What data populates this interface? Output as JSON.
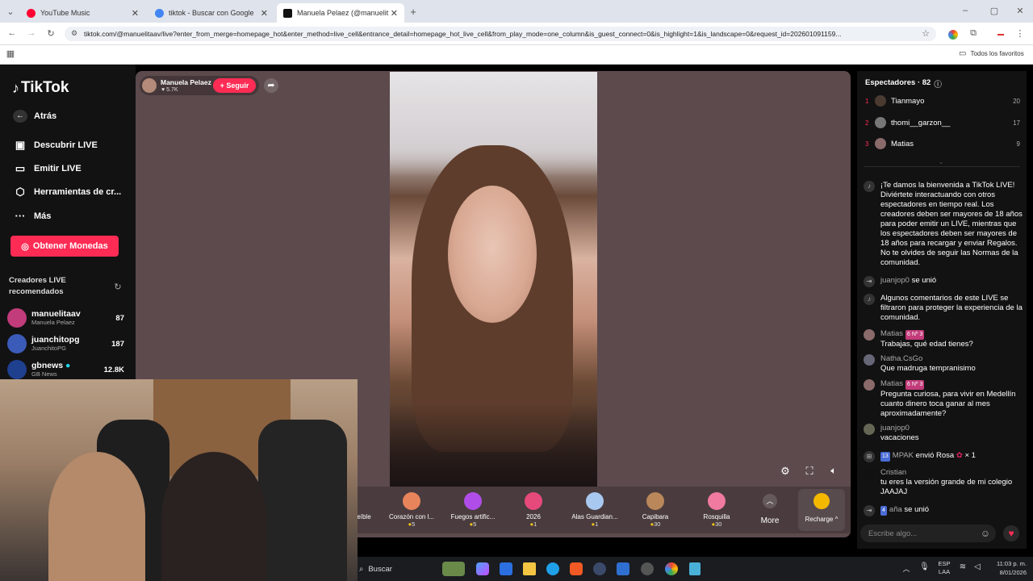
{
  "browser": {
    "tabs": [
      {
        "title": "YouTube Music",
        "color": "#ff0033"
      },
      {
        "title": "tiktok - Buscar con Google",
        "color": "#4285f4"
      },
      {
        "title": "Manuela Pelaez (@manuelit",
        "color": "#111111"
      }
    ],
    "url": "tiktok.com/@manuelitaav/live?enter_from_merge=homepage_hot&enter_method=live_cell&entrance_detail=homepage_hot_live_cell&from_play_mode=one_column&is_guest_connect=0&is_highlight=1&is_landscape=0&request_id=202601091159...",
    "bookmarks_label": "Todos los favoritos"
  },
  "tiktok": {
    "logo": "TikTok",
    "nav": [
      {
        "label": "Atrás",
        "icon": "back-arrow-icon"
      },
      {
        "label": "Descubrir LIVE",
        "icon": "live-calendar-icon"
      },
      {
        "label": "Emitir LIVE",
        "icon": "camera-icon"
      },
      {
        "label": "Herramientas de cr...",
        "icon": "tools-icon"
      },
      {
        "label": "Más",
        "icon": "more-icon"
      }
    ],
    "coins_button": "Obtener Monedas",
    "recommended_title": "Creadores LIVE recomendados",
    "creators": [
      {
        "name": "manuelitaav",
        "sub": "Manuela Pelaez",
        "count": "87",
        "color": "#c23b7a"
      },
      {
        "name": "juanchitopg",
        "sub": "JuanchitoPG",
        "count": "187",
        "color": "#3b5bb8"
      },
      {
        "name": "gbnews",
        "sub": "GB News",
        "count": "12.8K",
        "color": "#1f3f8f"
      }
    ]
  },
  "stream": {
    "host_name": "Manuela Pelaez",
    "host_likes": "5.7K",
    "follow_label": "+ Seguir",
    "gifts": [
      {
        "name": "eíble",
        "price": ""
      },
      {
        "name": "Corazón con l...",
        "price": "5",
        "color": "#e8845c"
      },
      {
        "name": "Fuegos artific...",
        "price": "5",
        "color": "#b04de8"
      },
      {
        "name": "2026",
        "price": "1",
        "color": "#e64a7a"
      },
      {
        "name": "Alas Guardian...",
        "price": "1",
        "color": "#a9c8ef"
      },
      {
        "name": "Capibara",
        "price": "30",
        "color": "#b9875a"
      },
      {
        "name": "Rosquilla",
        "price": "30",
        "color": "#f07aa0"
      }
    ],
    "more_label": "More",
    "recharge_label": "Recharge"
  },
  "chat": {
    "viewers_title": "Espectadores · 82",
    "top_viewers": [
      {
        "rank": "1",
        "name": "Tianmayo",
        "score": "20"
      },
      {
        "rank": "2",
        "name": "thomi__garzon__",
        "score": "17"
      },
      {
        "rank": "3",
        "name": "Matias",
        "score": "9"
      }
    ],
    "welcome": "¡Te damos la bienvenida a TikTok LIVE! Diviértete interactuando con otros espectadores en tiempo real. Los creadores deben ser mayores de 18 años para poder emitir un LIVE, mientras que los espectadores deben ser mayores de 18 años para recargar y enviar Regalos. No te olvides de seguir las Normas de la comunidad.",
    "join1_user": "juanjop0",
    "join_text": "se unió",
    "filter_notice": "Algunos comentarios de este LIVE se filtraron para proteger la experiencia de la comunidad.",
    "messages": [
      {
        "user": "Matias",
        "badge": "6 Nº 3",
        "text": "Trabajas, qué edad tienes?"
      },
      {
        "user": "Natha.CsGo",
        "badge": "",
        "text": "Que madruga tempranisimo"
      },
      {
        "user": "Matias",
        "badge": "6 Nº 3",
        "text": "Pregunta curiosa, para vivir en Medellín cuanto dinero toca ganar al mes aproximadamente?"
      },
      {
        "user": "juanjop0",
        "badge": "",
        "text": "vacaciones"
      }
    ],
    "gift_msg": {
      "badge": "13",
      "user": "MPAK",
      "text": "envió Rosa",
      "count": "× 1"
    },
    "cristian": {
      "user": "Cristian",
      "text": "tu eres la versión grande de mi colegio JAAJAJ"
    },
    "join2": {
      "badge": "4",
      "user": "aña",
      "text": "se unió"
    },
    "input_placeholder": "Escribe algo..."
  },
  "taskbar": {
    "search": "Buscar",
    "lang": "ESP LAA",
    "time": "11:03 p. m.",
    "date": "8/01/2026"
  }
}
